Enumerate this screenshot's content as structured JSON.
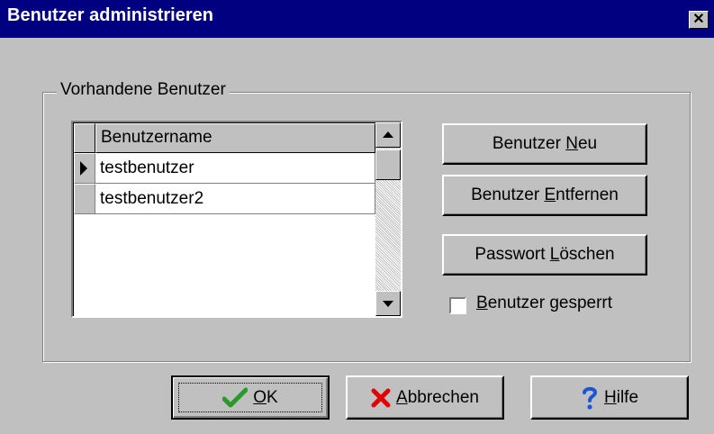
{
  "window": {
    "title": "Benutzer administrieren",
    "close_glyph": "✕"
  },
  "group": {
    "legend": "Vorhandene Benutzer"
  },
  "grid": {
    "column_header": "Benutzername",
    "rows": [
      {
        "name": "testbenutzer",
        "current": true
      },
      {
        "name": "testbenutzer2",
        "current": false
      }
    ]
  },
  "actions": {
    "new_user": {
      "pre": "Benutzer ",
      "hot": "N",
      "post": "eu"
    },
    "remove_user": {
      "pre": "Benutzer ",
      "hot": "E",
      "post": "ntfernen"
    },
    "clear_password": {
      "pre": "Passwort ",
      "hot": "L",
      "post": "öschen"
    }
  },
  "locked": {
    "hot": "B",
    "post": "enutzer gesperrt",
    "checked": false
  },
  "footer": {
    "ok": {
      "hot": "O",
      "post": "K"
    },
    "cancel": {
      "hot": "A",
      "post": "bbrechen"
    },
    "help": {
      "hot": "H",
      "post": "ilfe"
    }
  },
  "colors": {
    "titlebar": "#000080",
    "face": "#c0c0c0",
    "ok_check": "#2a9a2a",
    "cancel_x": "#e00000",
    "help_q": "#1a56d6"
  },
  "icons": {
    "ok": "checkmark-icon",
    "cancel": "x-icon",
    "help": "question-icon"
  }
}
